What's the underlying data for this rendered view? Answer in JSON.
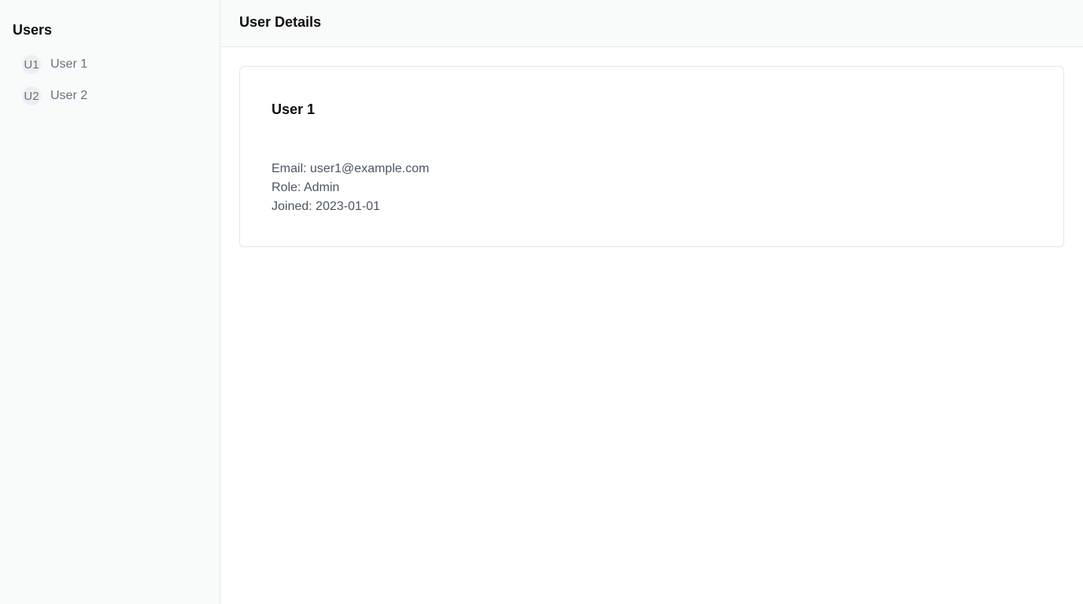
{
  "sidebar": {
    "title": "Users",
    "items": [
      {
        "initials": "U1",
        "label": "User 1"
      },
      {
        "initials": "U2",
        "label": "User 2"
      }
    ]
  },
  "header": {
    "title": "User Details"
  },
  "detail": {
    "name": "User 1",
    "email_line": "Email: user1@example.com",
    "role_line": "Role: Admin",
    "joined_line": "Joined: 2023-01-01"
  },
  "colors": {
    "sidebar_bg": "#f9fafa",
    "text_primary": "#0f0f0f",
    "text_muted": "#6b7280",
    "border": "#e5e7eb"
  }
}
